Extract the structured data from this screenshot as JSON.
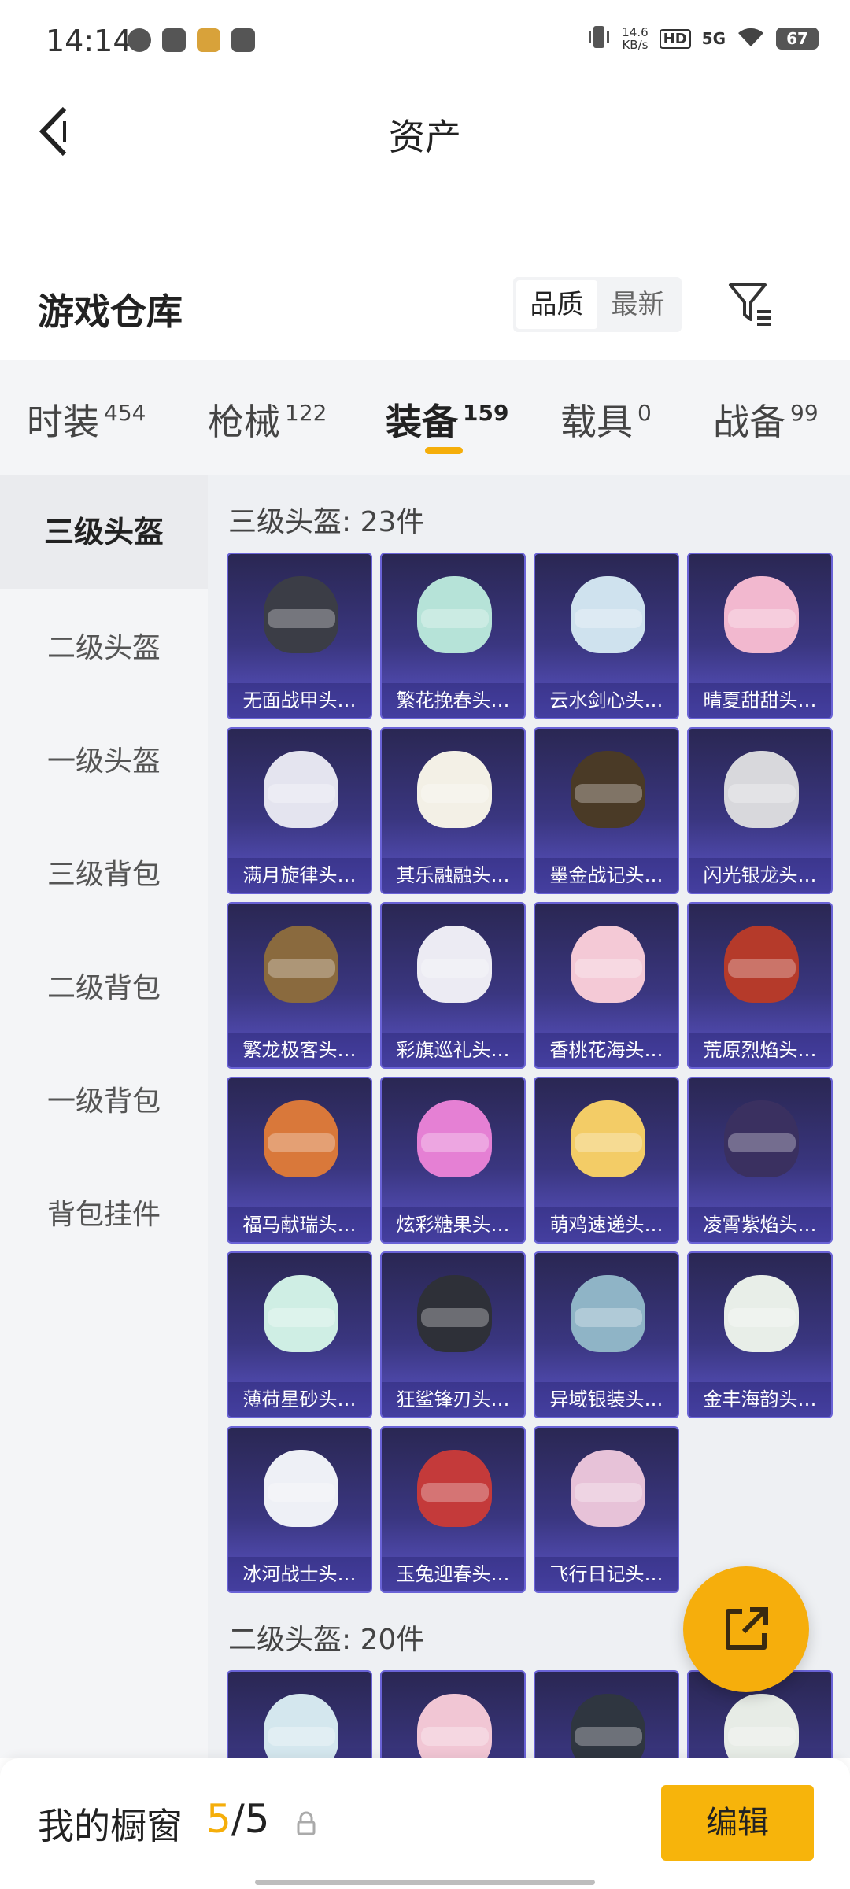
{
  "status_bar": {
    "time": "14:14",
    "speed": "14.6",
    "speed_unit": "KB/s",
    "hd": "HD",
    "network": "5G",
    "battery": "67"
  },
  "header": {
    "title": "资产"
  },
  "warehouse": {
    "title": "游戏仓库",
    "sort_options": [
      "品质",
      "最新"
    ],
    "sort_selected": "品质"
  },
  "tabs": [
    {
      "label": "时装",
      "count": "454"
    },
    {
      "label": "枪械",
      "count": "122"
    },
    {
      "label": "装备",
      "count": "159"
    },
    {
      "label": "载具",
      "count": "0"
    },
    {
      "label": "战备",
      "count": "99"
    }
  ],
  "active_tab": "装备",
  "sidebar": {
    "items": [
      "三级头盔",
      "二级头盔",
      "一级头盔",
      "三级背包",
      "二级背包",
      "一级背包",
      "背包挂件"
    ],
    "active": "三级头盔"
  },
  "sections": [
    {
      "title": "三级头盔: 23件",
      "items": [
        "无面战甲头…",
        "繁花挽春头…",
        "云水剑心头…",
        "晴夏甜甜头…",
        "满月旋律头…",
        "其乐融融头…",
        "墨金战记头…",
        "闪光银龙头…",
        "繁龙极客头…",
        "彩旗巡礼头…",
        "香桃花海头…",
        "荒原烈焰头…",
        "福马献瑞头…",
        "炫彩糖果头…",
        "萌鸡速递头…",
        "凌霄紫焰头…",
        "薄荷星砂头…",
        "狂鲨锋刃头…",
        "异域银装头…",
        "金丰海韵头…",
        "冰河战士头…",
        "玉兔迎春头…",
        "飞行日记头…"
      ],
      "item_colors": [
        "#3b3d46",
        "#b6e3d8",
        "#cfe2ee",
        "#f2b8cf",
        "#e4e4ef",
        "#f3f0e6",
        "#4a3a26",
        "#d8d8dc",
        "#8a6a3e",
        "#ecebf3",
        "#f4c9d6",
        "#b53a2a",
        "#d9783a",
        "#e580d4",
        "#f3cc66",
        "#3a3060",
        "#cfeee4",
        "#2e3038",
        "#8fb4c6",
        "#e8eee8",
        "#eef0f6",
        "#c43a3a",
        "#e7c2d8"
      ]
    },
    {
      "title": "二级头盔: 20件",
      "items": [
        "",
        "",
        "",
        ""
      ],
      "item_colors": [
        "#d4e7ee",
        "#f1c6d4",
        "#2f3640",
        "#e7ece6"
      ]
    }
  ],
  "showcase": {
    "label": "我的橱窗",
    "current": "5",
    "total": "/5",
    "edit_label": "编辑"
  },
  "colors": {
    "accent": "#f5ae0a",
    "card_purple": "#3a3680"
  }
}
